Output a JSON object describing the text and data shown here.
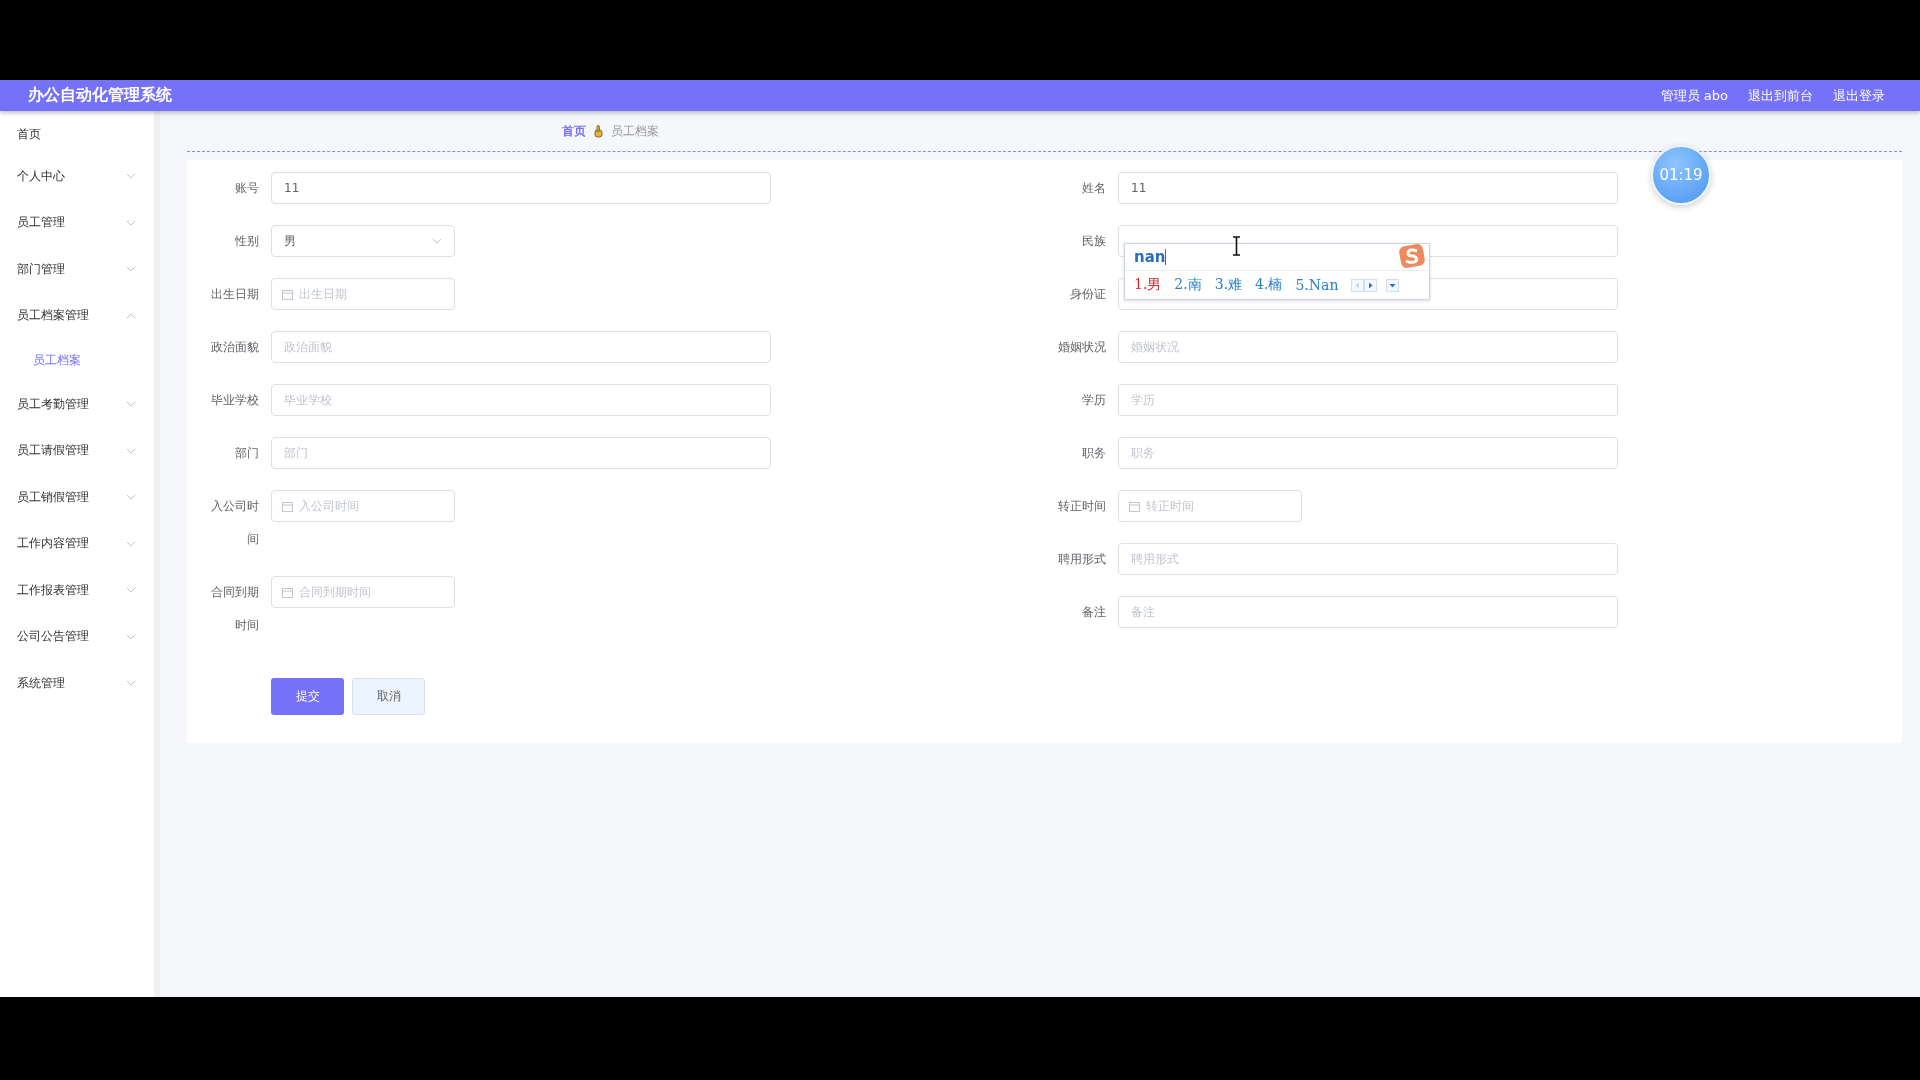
{
  "header": {
    "title": "办公自动化管理系统",
    "user": "管理员 abo",
    "links": [
      "退出到前台",
      "退出登录"
    ]
  },
  "sidebar": {
    "items": [
      {
        "label": "首页",
        "kind": "link"
      },
      {
        "label": "个人中心",
        "kind": "group",
        "expanded": false
      },
      {
        "label": "员工管理",
        "kind": "group",
        "expanded": false
      },
      {
        "label": "部门管理",
        "kind": "group",
        "expanded": false
      },
      {
        "label": "员工档案管理",
        "kind": "group",
        "expanded": true,
        "children": [
          {
            "label": "员工档案",
            "selected": true
          }
        ]
      },
      {
        "label": "员工考勤管理",
        "kind": "group",
        "expanded": false
      },
      {
        "label": "员工请假管理",
        "kind": "group",
        "expanded": false
      },
      {
        "label": "员工销假管理",
        "kind": "group",
        "expanded": false
      },
      {
        "label": "工作内容管理",
        "kind": "group",
        "expanded": false
      },
      {
        "label": "工作报表管理",
        "kind": "group",
        "expanded": false
      },
      {
        "label": "公司公告管理",
        "kind": "group",
        "expanded": false
      },
      {
        "label": "系统管理",
        "kind": "group",
        "expanded": false
      }
    ]
  },
  "breadcrumb": [
    {
      "label": "首页",
      "current": false
    },
    {
      "label": "员工档案",
      "current": true
    }
  ],
  "form": {
    "left": [
      {
        "label": "账号",
        "kind": "text",
        "value": "11"
      },
      {
        "label": "性别",
        "kind": "select",
        "value": "男"
      },
      {
        "label": "出生日期",
        "kind": "date",
        "placeholder": "出生日期"
      },
      {
        "label": "政治面貌",
        "kind": "text",
        "placeholder": "政治面貌"
      },
      {
        "label": "毕业学校",
        "kind": "text",
        "placeholder": "毕业学校"
      },
      {
        "label": "部门",
        "kind": "text",
        "placeholder": "部门"
      },
      {
        "label": "入公司时间",
        "kind": "date",
        "placeholder": "入公司时间"
      },
      {
        "label": "合同到期时间",
        "kind": "date",
        "placeholder": "合同到期时间"
      }
    ],
    "right": [
      {
        "label": "姓名",
        "kind": "text",
        "value": "11"
      },
      {
        "label": "民族",
        "kind": "text"
      },
      {
        "label": "身份证",
        "kind": "text"
      },
      {
        "label": "婚姻状况",
        "kind": "text",
        "placeholder": "婚姻状况"
      },
      {
        "label": "学历",
        "kind": "text",
        "placeholder": "学历"
      },
      {
        "label": "职务",
        "kind": "text",
        "placeholder": "职务"
      },
      {
        "label": "转正时间",
        "kind": "date",
        "placeholder": "转正时间"
      },
      {
        "label": "聘用形式",
        "kind": "text",
        "placeholder": "聘用形式"
      },
      {
        "label": "备注",
        "kind": "text",
        "placeholder": "备注"
      }
    ],
    "buttons": [
      {
        "label": "提交",
        "kind": "primary"
      },
      {
        "label": "取消",
        "kind": "default"
      }
    ]
  },
  "ime": {
    "composition": "nan",
    "candidates": [
      {
        "label": "1.男",
        "selected": true
      },
      {
        "label": "2.南",
        "selected": false
      },
      {
        "label": "3.难",
        "selected": false
      },
      {
        "label": "4.楠",
        "selected": false
      },
      {
        "label": "5.Nan",
        "selected": false
      }
    ]
  },
  "timer": "01:19"
}
